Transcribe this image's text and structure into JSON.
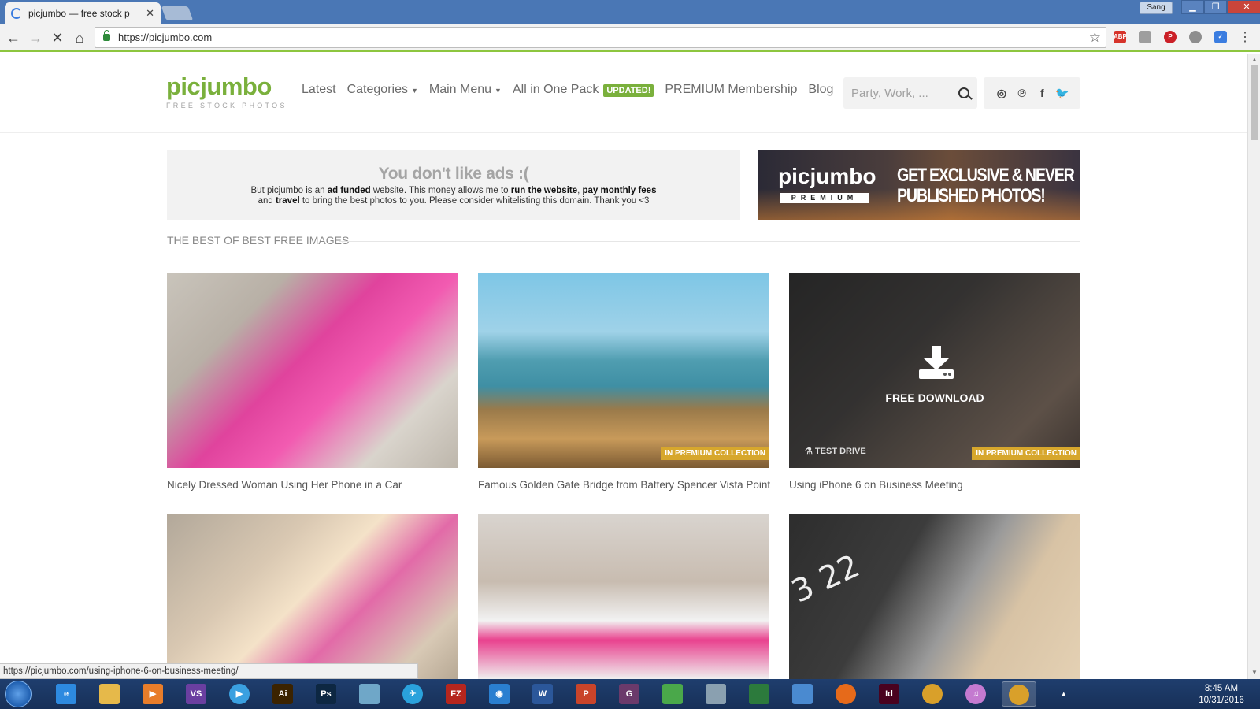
{
  "browser": {
    "tab_title": "picjumbo — free stock p",
    "tab_close": "✕",
    "user_button": "Sang",
    "url": "https://picjumbo.com",
    "window_buttons": {
      "minimize": "▁",
      "maximize": "❐",
      "close": "✕"
    },
    "extensions": [
      {
        "name": "adblock-plus",
        "label": "ABP",
        "color": "#d6332a"
      },
      {
        "name": "extension-2",
        "label": "",
        "color": "#9e9e9e"
      },
      {
        "name": "pinterest",
        "label": "P",
        "color": "#cb2027"
      },
      {
        "name": "extension-4",
        "label": "",
        "color": "#8e8e8e"
      },
      {
        "name": "extension-5",
        "label": "✓",
        "color": "#3b7de0"
      }
    ],
    "menu_icon": "⋮"
  },
  "site": {
    "logo": {
      "main": "picjumbo",
      "sub": "FREE STOCK PHOTOS"
    },
    "nav": {
      "latest": "Latest",
      "categories": "Categories",
      "main_menu": "Main Menu",
      "all_in_one": "All in One Pack",
      "updated_badge": "UPDATED!",
      "premium": "PREMIUM Membership",
      "blog": "Blog"
    },
    "search": {
      "placeholder": "Party, Work, ..."
    },
    "social": {
      "instagram": "◎",
      "pinterest": "℗",
      "facebook": "f",
      "twitter": "🐦"
    }
  },
  "adblock": {
    "title": "You don't like ads :(",
    "line1_a": "But picjumbo is an ",
    "line1_b": "ad funded",
    "line1_c": " website. This money allows me to ",
    "line1_d": "run the website",
    "line1_e": ", ",
    "line1_f": "pay monthly fees",
    "line2_a": "and ",
    "line2_b": "travel",
    "line2_c": " to bring the best photos to you. Please consider whitelisting this domain. Thank you <3"
  },
  "premium_banner": {
    "logo": "picjumbo",
    "premium": "PREMIUM",
    "line1": "GET EXCLUSIVE & NEVER",
    "line2": "PUBLISHED PHOTOS!"
  },
  "section": {
    "title": "THE BEST OF BEST FREE IMAGES"
  },
  "cards": [
    {
      "caption": "Nicely Dressed Woman Using Her Phone in a Car"
    },
    {
      "caption": "Famous Golden Gate Bridge from Battery Spencer Vista Point",
      "tag": "IN PREMIUM COLLECTION"
    },
    {
      "caption": "Using iPhone 6 on Business Meeting",
      "tag": "IN PREMIUM COLLECTION",
      "overlay": "FREE DOWNLOAD",
      "test_drive": "TEST DRIVE"
    },
    {
      "caption": ""
    },
    {
      "caption": ""
    },
    {
      "caption": "",
      "number": "3 22"
    }
  ],
  "status_bar": "https://picjumbo.com/using-iphone-6-on-business-meeting/",
  "taskbar": {
    "apps": [
      {
        "name": "internet-explorer",
        "label": "e",
        "color": "#2d8ae0"
      },
      {
        "name": "file-explorer",
        "label": "",
        "color": "#e6b94a"
      },
      {
        "name": "media-player",
        "label": "▶",
        "color": "#e87d2a"
      },
      {
        "name": "visual-studio",
        "label": "VS",
        "color": "#6a3fa0"
      },
      {
        "name": "media-app",
        "label": "▶",
        "color": "#3aa0e0"
      },
      {
        "name": "illustrator",
        "label": "Ai",
        "color": "#3b2300"
      },
      {
        "name": "photoshop",
        "label": "Ps",
        "color": "#0d2742"
      },
      {
        "name": "tool-app",
        "label": "",
        "color": "#6fa7c8"
      },
      {
        "name": "telegram",
        "label": "✈",
        "color": "#2aa2dc"
      },
      {
        "name": "filezilla",
        "label": "FZ",
        "color": "#b5261e"
      },
      {
        "name": "browser-app",
        "label": "◉",
        "color": "#2a7fd0"
      },
      {
        "name": "word",
        "label": "W",
        "color": "#2b579a"
      },
      {
        "name": "powerpoint",
        "label": "P",
        "color": "#c9442a"
      },
      {
        "name": "pdf-app",
        "label": "G",
        "color": "#6b3a6b"
      },
      {
        "name": "sheet-app",
        "label": "",
        "color": "#4aa84a"
      },
      {
        "name": "window-app",
        "label": "",
        "color": "#8aa0b0"
      },
      {
        "name": "globe-app",
        "label": "",
        "color": "#2c7a3c"
      },
      {
        "name": "device-app",
        "label": "",
        "color": "#4a8ad0"
      },
      {
        "name": "firefox",
        "label": "",
        "color": "#e66a1a"
      },
      {
        "name": "indesign",
        "label": "Id",
        "color": "#49021f"
      },
      {
        "name": "chrome",
        "label": "",
        "color": "#d9a02a"
      },
      {
        "name": "itunes",
        "label": "♫",
        "color": "#c47ad0"
      },
      {
        "name": "chrome-active",
        "label": "",
        "color": "#d9a02a"
      }
    ],
    "tray": "▴",
    "clock_time": "8:45 AM",
    "clock_date": "10/31/2016"
  }
}
